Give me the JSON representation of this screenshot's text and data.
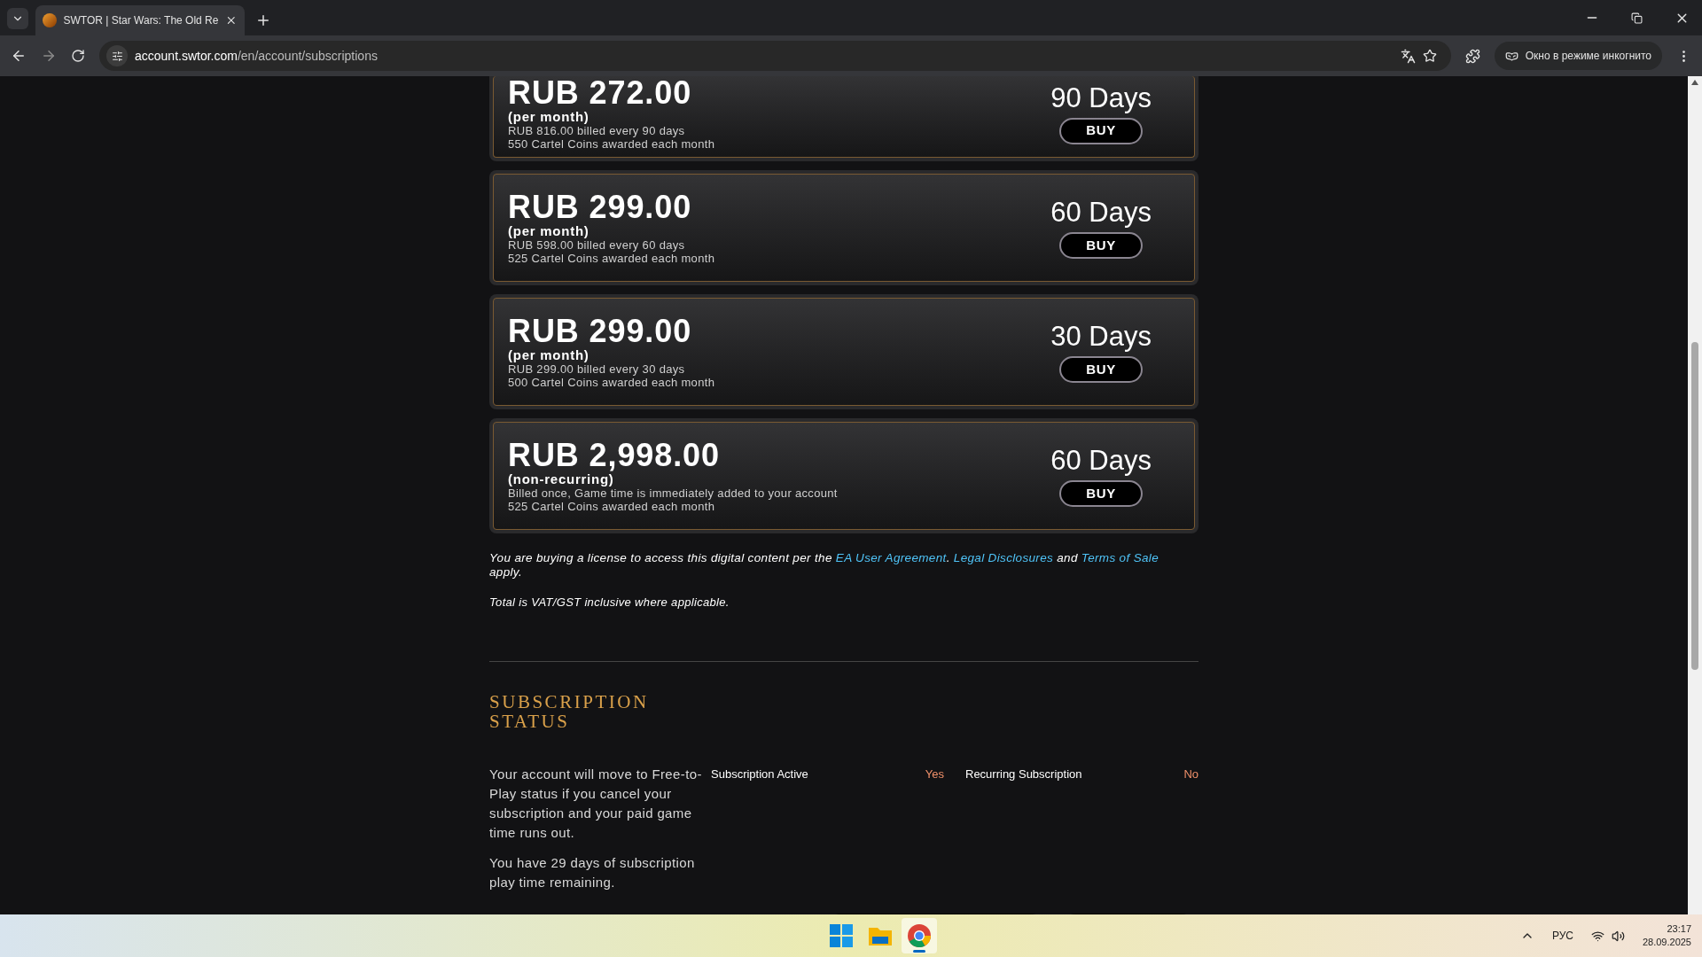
{
  "browser": {
    "tab_title": "SWTOR | Star Wars: The Old Re",
    "url_host": "account.swtor.com",
    "url_path": "/en/account/subscriptions",
    "incognito_label": "Окно в режиме инкогнито"
  },
  "plans": [
    {
      "price": "RUB 272.00",
      "period": "(per month)",
      "details": [
        "RUB 816.00 billed every 90 days",
        "550 Cartel Coins awarded each month"
      ],
      "days": "90 Days",
      "buy_label": "BUY"
    },
    {
      "price": "RUB 299.00",
      "period": "(per month)",
      "details": [
        "RUB 598.00 billed every 60 days",
        "525 Cartel Coins awarded each month"
      ],
      "days": "60 Days",
      "buy_label": "BUY"
    },
    {
      "price": "RUB 299.00",
      "period": "(per month)",
      "details": [
        "RUB 299.00 billed every 30 days",
        "500 Cartel Coins awarded each month"
      ],
      "days": "30 Days",
      "buy_label": "BUY"
    },
    {
      "price": "RUB 2,998.00",
      "period": "(non-recurring)",
      "details": [
        "Billed once, Game time is immediately added to your account",
        "525 Cartel Coins awarded each month"
      ],
      "days": "60 Days",
      "buy_label": "BUY"
    }
  ],
  "legal": [
    {
      "kind": "text",
      "text": "You are buying a license to access this digital content per the "
    },
    {
      "kind": "link",
      "text": "EA User Agreement"
    },
    {
      "kind": "text",
      "text": ". "
    },
    {
      "kind": "link",
      "text": "Legal Disclosures"
    },
    {
      "kind": "text",
      "text": " and "
    },
    {
      "kind": "link",
      "text": "Terms of Sale"
    },
    {
      "kind": "text",
      "text": " apply."
    }
  ],
  "vat_note": "Total is VAT/GST inclusive where applicable.",
  "status": {
    "heading": "SUBSCRIPTION STATUS",
    "paragraphs": [
      "Your account will move to Free-to-Play status if you cancel your subscription and your paid game time runs out.",
      "You have 29 days of subscription play time remaining."
    ],
    "fields": [
      {
        "label": "Subscription Active",
        "value": "Yes"
      },
      {
        "label": "Recurring Subscription",
        "value": "No"
      }
    ]
  },
  "taskbar": {
    "apps": [
      {
        "kind": "start",
        "selected": false
      },
      {
        "kind": "files",
        "selected": false
      },
      {
        "kind": "browser",
        "selected": true
      }
    ],
    "language": "РУС",
    "time": "23:17",
    "date": "28.09.2025"
  }
}
